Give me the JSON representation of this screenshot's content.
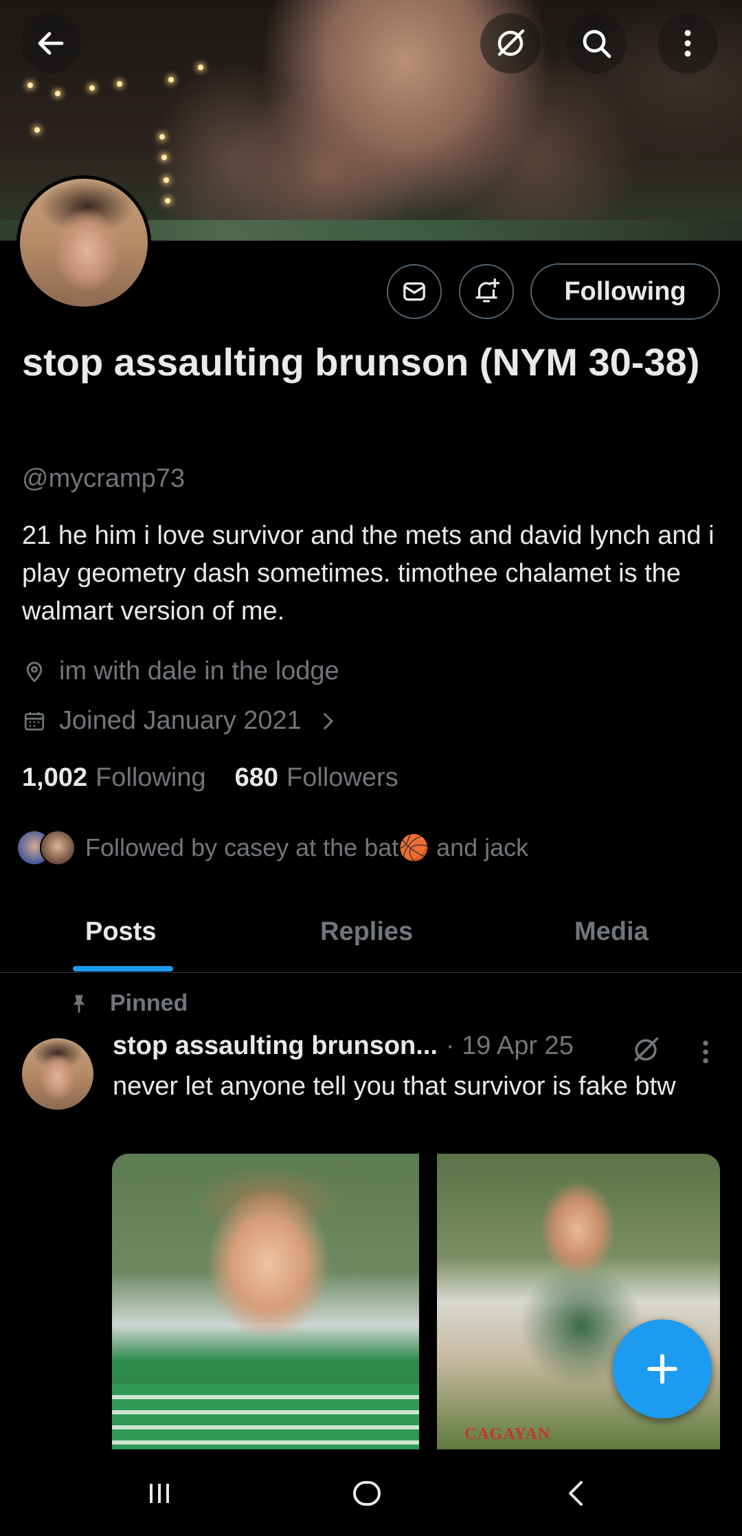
{
  "header": {
    "back_icon": "arrow-left-icon",
    "grok_icon": "grok-icon",
    "search_icon": "search-icon",
    "more_icon": "more-vertical-icon"
  },
  "profile": {
    "display_name": "stop assaulting brunson (NYM 30-38)",
    "handle": "@mycramp73",
    "bio": "21 he him i love survivor and the mets and david lynch and i play geometry dash sometimes. timothee chalamet is the walmart version of me.",
    "location": "im with dale in the lodge",
    "joined": "Joined January 2021",
    "following_count": "1,002",
    "following_label": "Following",
    "followers_count": "680",
    "followers_label": "Followers",
    "followed_by": "Followed by casey at the bat🏀 and jack"
  },
  "actions": {
    "message_icon": "mail-icon",
    "notify_icon": "bell-plus-icon",
    "follow_label": "Following"
  },
  "tabs": [
    {
      "label": "Posts",
      "active": true
    },
    {
      "label": "Replies",
      "active": false
    },
    {
      "label": "Media",
      "active": false
    }
  ],
  "pinned_post": {
    "pinned_label": "Pinned",
    "author": "stop assaulting brunson...",
    "date": "· 19 Apr 25",
    "text": "never let anyone tell you that survivor is fake btw",
    "image2_caption": "CAGAYAN"
  },
  "colors": {
    "accent": "#1d9bf0",
    "text_primary": "#e7e9ea",
    "text_secondary": "#71767b"
  }
}
